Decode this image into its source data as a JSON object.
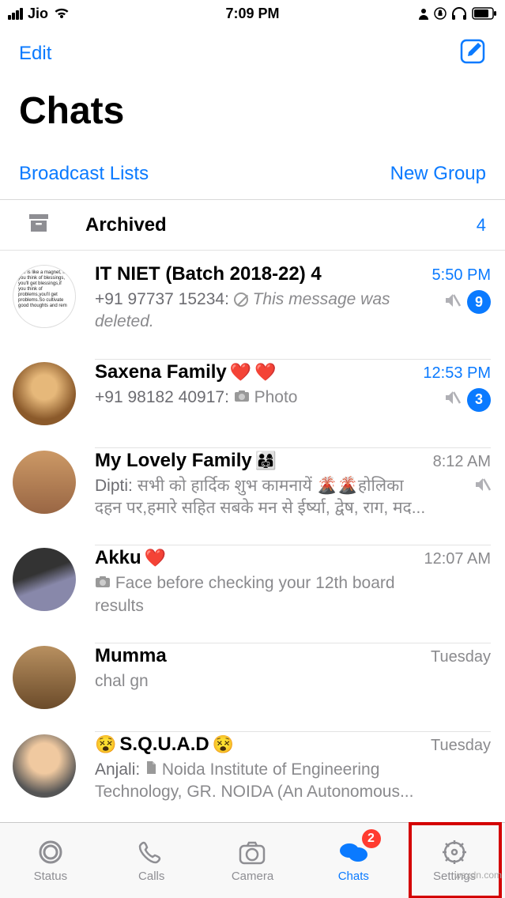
{
  "status_bar": {
    "carrier": "Jio",
    "time": "7:09 PM"
  },
  "nav": {
    "edit": "Edit"
  },
  "title": "Chats",
  "sub_actions": {
    "broadcast": "Broadcast Lists",
    "new_group": "New Group"
  },
  "archived": {
    "label": "Archived",
    "count": "4"
  },
  "chats": [
    {
      "name": "IT NIET (Batch 2018-22) 4",
      "time": "5:50 PM",
      "time_blue": true,
      "sender": "+91 97737 15234",
      "msg": "This message was deleted.",
      "deleted": true,
      "muted": true,
      "badge": "9"
    },
    {
      "name": "Saxena Family",
      "hearts": 2,
      "time": "12:53 PM",
      "time_blue": true,
      "sender": "+91 98182 40917",
      "photo": true,
      "msg": "Photo",
      "muted": true,
      "badge": "3"
    },
    {
      "name": "My Lovely Family",
      "family_emoji": true,
      "time": "8:12 AM",
      "sender": "Dipti",
      "msg": "सभी को हार्दिक शुभ कामनायें 🌋🌋होलिका दहन पर,हमारे सहित  सबके मन से ईर्ष्या, द्वेष, राग, मद...",
      "muted": true
    },
    {
      "name": "Akku",
      "hearts": 1,
      "time": "12:07 AM",
      "photo_prefix": true,
      "msg": "Face before checking your 12th board results"
    },
    {
      "name": "Mumma",
      "time": "Tuesday",
      "msg": "chal gn"
    },
    {
      "name": "S.Q.U.A.D",
      "dizzy": true,
      "time": "Tuesday",
      "sender": "Anjali",
      "attach": true,
      "msg": "Noida Institute of Engineering Technology, GR. NOIDA (An Autonomous..."
    }
  ],
  "tabs": {
    "status": "Status",
    "calls": "Calls",
    "camera": "Camera",
    "chats": "Chats",
    "settings": "Settings",
    "chats_badge": "2"
  },
  "watermark": "wsxdn.com"
}
